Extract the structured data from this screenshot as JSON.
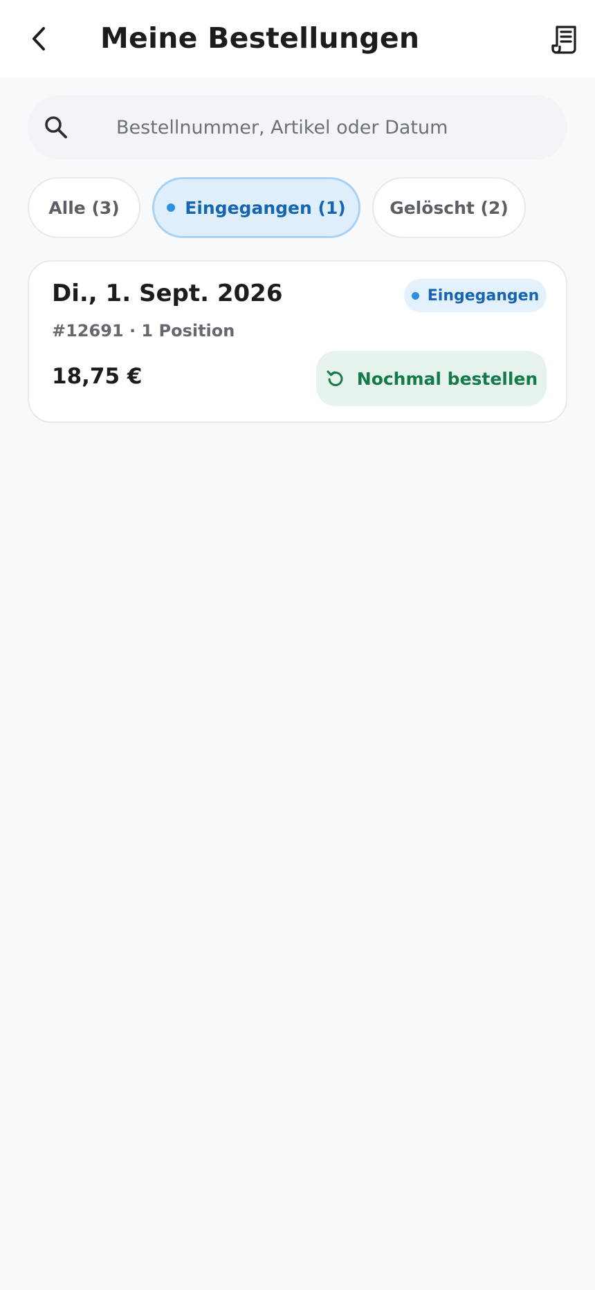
{
  "header": {
    "title": "Meine Bestellungen",
    "back_icon": "chevron-left-icon",
    "receipt_icon": "receipt-icon"
  },
  "search": {
    "placeholder": "Bestellnummer, Artikel oder Datum",
    "value": "",
    "icon": "search-icon"
  },
  "filters": [
    {
      "label": "Alle (3)",
      "active": false
    },
    {
      "label": "Eingegangen (1)",
      "active": true
    },
    {
      "label": "Gelöscht (2)",
      "active": false
    }
  ],
  "orders": [
    {
      "date": "Di., 1. Sept. 2026",
      "status": "Eingegangen",
      "meta": "#12691 · 1 Position",
      "total": "18,75 €",
      "reorder_label": "Nochmal bestellen",
      "reorder_icon": "refresh-icon"
    }
  ],
  "colors": {
    "accent_blue": "#1565b3",
    "status_dot": "#2f8ee3",
    "reorder_green": "#137a4a",
    "background": "#f8f9fb"
  }
}
